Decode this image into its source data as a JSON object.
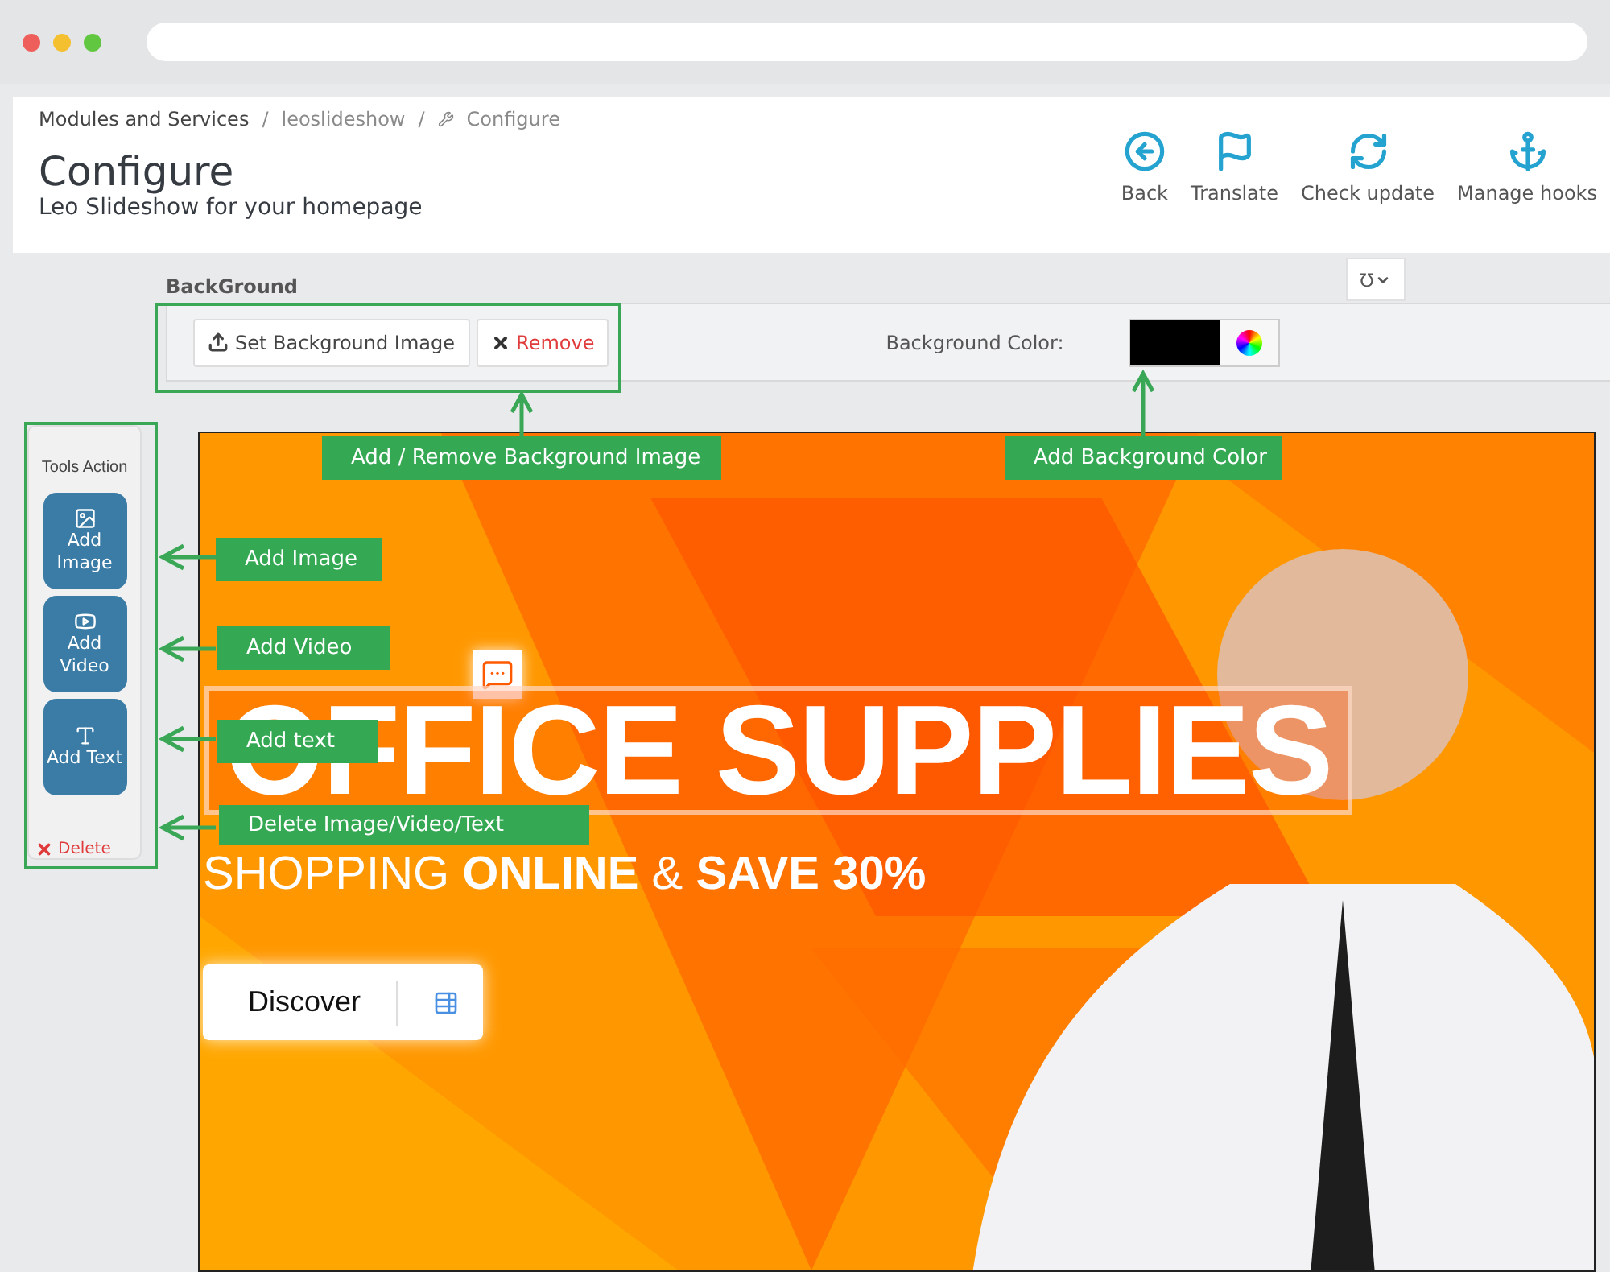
{
  "browser": {
    "dots": [
      {
        "color": "#ee5f5b"
      },
      {
        "color": "#f5c02f"
      },
      {
        "color": "#62c740"
      }
    ]
  },
  "breadcrumb": {
    "items": [
      "Modules and Services",
      "leoslideshow",
      "Configure"
    ],
    "separator": "/"
  },
  "header": {
    "title": "Configure",
    "subtitle": "Leo Slideshow for your homepage"
  },
  "toolbar": [
    {
      "label": "Back",
      "kind": "back"
    },
    {
      "label": "Translate",
      "kind": "translate"
    },
    {
      "label": "Check update",
      "kind": "update"
    },
    {
      "label": "Manage hooks",
      "kind": "hooks"
    }
  ],
  "background": {
    "title": "BackGround",
    "dropdown": "Ʊ",
    "buttons": [
      {
        "label": "Set Background Image",
        "kind": "upload"
      },
      {
        "label": "Remove",
        "kind": "remove"
      }
    ],
    "color_label": "Background Color:",
    "color": "#000000"
  },
  "tools": {
    "title": "Tools Action",
    "items": [
      {
        "label": "Add Image",
        "kind": "image"
      },
      {
        "label": "Add Video",
        "kind": "video"
      },
      {
        "label": "Add Text",
        "kind": "text"
      },
      {
        "label": "Delete",
        "kind": "delete"
      }
    ]
  },
  "slide": {
    "title": "OFFICE SUPPLIES",
    "subtitle": "SHOPPING **ONLINE** & **SAVE 30%**",
    "button": "Discover"
  },
  "annotations": [
    "Add / Remove Background Image",
    "Add Background Color",
    "Add Image",
    "Add Video",
    "Add text",
    "Delete Image/Video/Text"
  ]
}
